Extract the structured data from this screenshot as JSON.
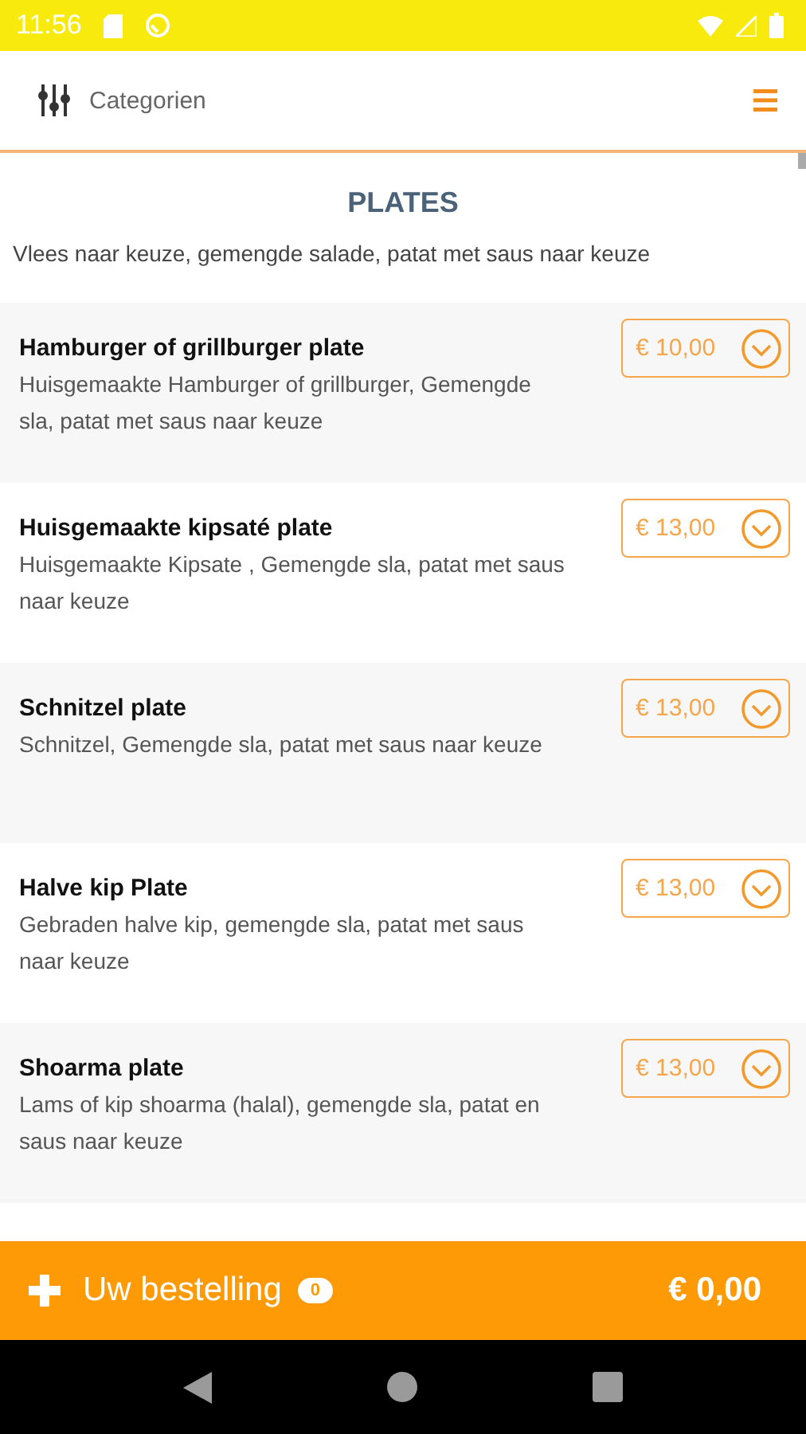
{
  "status_bar": {
    "time": "11:56"
  },
  "header": {
    "label": "Categorien"
  },
  "section": {
    "title": "PLATES",
    "description": "Vlees naar keuze, gemengde salade, patat met saus naar keuze"
  },
  "items": [
    {
      "name": "Hamburger of grillburger plate",
      "description": "Huisgemaakte Hamburger of grillburger, Gemengde sla, patat met saus naar keuze",
      "price": "€ 10,00"
    },
    {
      "name": "Huisgemaakte kipsaté plate",
      "description": "Huisgemaakte Kipsate , Gemengde sla, patat met saus naar keuze",
      "price": "€ 13,00"
    },
    {
      "name": "Schnitzel plate",
      "description": "Schnitzel, Gemengde sla, patat met saus naar keuze",
      "price": "€ 13,00"
    },
    {
      "name": "Halve kip Plate",
      "description": "Gebraden halve kip, gemengde sla, patat met saus naar keuze",
      "price": "€ 13,00"
    },
    {
      "name": "Shoarma plate",
      "description": "Lams of kip shoarma (halal), gemengde sla, patat en saus naar keuze",
      "price": "€ 13,00"
    }
  ],
  "order_bar": {
    "label": "Uw bestelling",
    "count": "0",
    "total": "€ 0,00"
  }
}
